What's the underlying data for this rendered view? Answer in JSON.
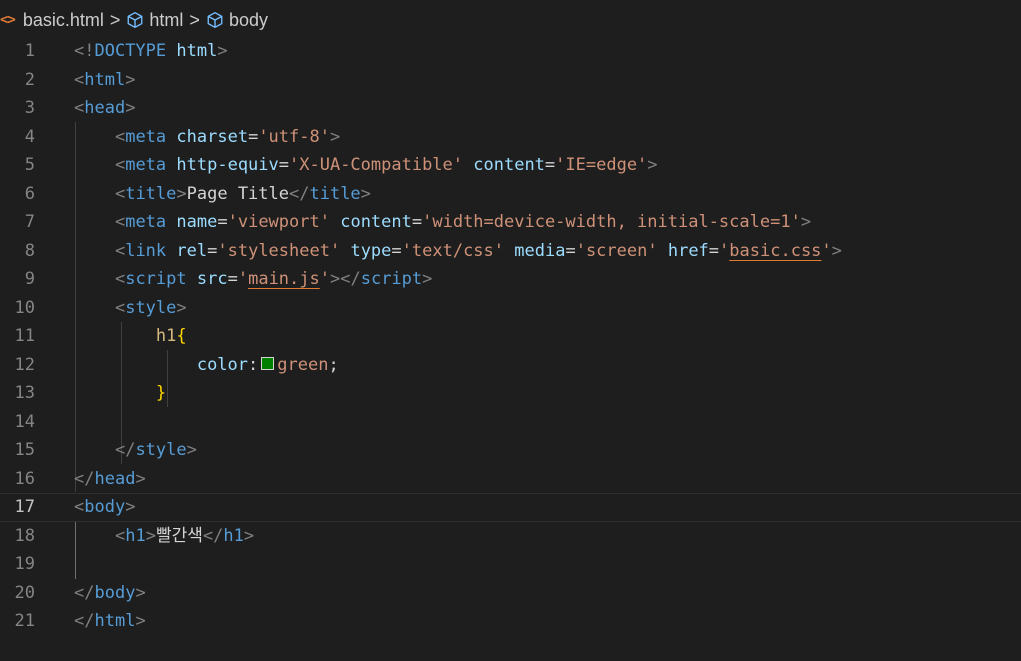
{
  "breadcrumb": {
    "file_icon": "<>",
    "file": "basic.html",
    "items": [
      "html",
      "body"
    ],
    "separator": ">",
    "symbol_icon": "cube-outline-icon"
  },
  "editor": {
    "current_line": 17,
    "color_swatch": "#008000",
    "lines": [
      {
        "n": "1",
        "t": [
          [
            "p",
            "<!"
          ],
          [
            "k",
            "DOCTYPE"
          ],
          [
            "x",
            " "
          ],
          [
            "a",
            "html"
          ],
          [
            "p",
            ">"
          ]
        ]
      },
      {
        "n": "2",
        "t": [
          [
            "p",
            "<"
          ],
          [
            "k",
            "html"
          ],
          [
            "p",
            ">"
          ]
        ]
      },
      {
        "n": "3",
        "t": [
          [
            "p",
            "<"
          ],
          [
            "k",
            "head"
          ],
          [
            "p",
            ">"
          ]
        ]
      },
      {
        "n": "4",
        "t": [
          [
            "x",
            "    "
          ],
          [
            "p",
            "<"
          ],
          [
            "k",
            "meta"
          ],
          [
            "x",
            " "
          ],
          [
            "a",
            "charset"
          ],
          [
            "x",
            "="
          ],
          [
            "s",
            "'utf-8'"
          ],
          [
            "p",
            ">"
          ]
        ]
      },
      {
        "n": "5",
        "t": [
          [
            "x",
            "    "
          ],
          [
            "p",
            "<"
          ],
          [
            "k",
            "meta"
          ],
          [
            "x",
            " "
          ],
          [
            "a",
            "http-equiv"
          ],
          [
            "x",
            "="
          ],
          [
            "s",
            "'X-UA-Compatible'"
          ],
          [
            "x",
            " "
          ],
          [
            "a",
            "content"
          ],
          [
            "x",
            "="
          ],
          [
            "s",
            "'IE=edge'"
          ],
          [
            "p",
            ">"
          ]
        ]
      },
      {
        "n": "6",
        "t": [
          [
            "x",
            "    "
          ],
          [
            "p",
            "<"
          ],
          [
            "k",
            "title"
          ],
          [
            "p",
            ">"
          ],
          [
            "x",
            "Page Title"
          ],
          [
            "p",
            "</"
          ],
          [
            "k",
            "title"
          ],
          [
            "p",
            ">"
          ]
        ]
      },
      {
        "n": "7",
        "t": [
          [
            "x",
            "    "
          ],
          [
            "p",
            "<"
          ],
          [
            "k",
            "meta"
          ],
          [
            "x",
            " "
          ],
          [
            "a",
            "name"
          ],
          [
            "x",
            "="
          ],
          [
            "s",
            "'viewport'"
          ],
          [
            "x",
            " "
          ],
          [
            "a",
            "content"
          ],
          [
            "x",
            "="
          ],
          [
            "s",
            "'width=device-width, initial-scale=1'"
          ],
          [
            "p",
            ">"
          ]
        ]
      },
      {
        "n": "8",
        "t": [
          [
            "x",
            "    "
          ],
          [
            "p",
            "<"
          ],
          [
            "k",
            "link"
          ],
          [
            "x",
            " "
          ],
          [
            "a",
            "rel"
          ],
          [
            "x",
            "="
          ],
          [
            "s",
            "'stylesheet'"
          ],
          [
            "x",
            " "
          ],
          [
            "a",
            "type"
          ],
          [
            "x",
            "="
          ],
          [
            "s",
            "'text/css'"
          ],
          [
            "x",
            " "
          ],
          [
            "a",
            "media"
          ],
          [
            "x",
            "="
          ],
          [
            "s",
            "'screen'"
          ],
          [
            "x",
            " "
          ],
          [
            "a",
            "href"
          ],
          [
            "x",
            "="
          ],
          [
            "s",
            "'"
          ],
          [
            "u",
            "basic.css"
          ],
          [
            "s",
            "'"
          ],
          [
            "p",
            ">"
          ]
        ]
      },
      {
        "n": "9",
        "t": [
          [
            "x",
            "    "
          ],
          [
            "p",
            "<"
          ],
          [
            "k",
            "script"
          ],
          [
            "x",
            " "
          ],
          [
            "a",
            "src"
          ],
          [
            "x",
            "="
          ],
          [
            "s",
            "'"
          ],
          [
            "u",
            "main.js"
          ],
          [
            "s",
            "'"
          ],
          [
            "p",
            "></"
          ],
          [
            "k",
            "script"
          ],
          [
            "p",
            ">"
          ]
        ]
      },
      {
        "n": "10",
        "t": [
          [
            "x",
            "    "
          ],
          [
            "p",
            "<"
          ],
          [
            "k",
            "style"
          ],
          [
            "p",
            ">"
          ]
        ]
      },
      {
        "n": "11",
        "t": [
          [
            "x",
            "        "
          ],
          [
            "sel",
            "h1"
          ],
          [
            "b",
            "{"
          ]
        ]
      },
      {
        "n": "12",
        "t": [
          [
            "x",
            "            "
          ],
          [
            "pr",
            "color"
          ],
          [
            "x",
            ":"
          ],
          [
            "sw",
            ""
          ],
          [
            "s",
            "green"
          ],
          [
            "x",
            ";"
          ]
        ]
      },
      {
        "n": "13",
        "t": [
          [
            "x",
            "        "
          ],
          [
            "b",
            "}"
          ]
        ]
      },
      {
        "n": "14",
        "t": []
      },
      {
        "n": "15",
        "t": [
          [
            "x",
            "    "
          ],
          [
            "p",
            "</"
          ],
          [
            "k",
            "style"
          ],
          [
            "p",
            ">"
          ]
        ]
      },
      {
        "n": "16",
        "t": [
          [
            "p",
            "</"
          ],
          [
            "k",
            "head"
          ],
          [
            "p",
            ">"
          ]
        ]
      },
      {
        "n": "17",
        "t": [
          [
            "p",
            "<"
          ],
          [
            "k",
            "body"
          ],
          [
            "p",
            ">"
          ]
        ]
      },
      {
        "n": "18",
        "t": [
          [
            "x",
            "    "
          ],
          [
            "p",
            "<"
          ],
          [
            "k",
            "h1"
          ],
          [
            "p",
            ">"
          ],
          [
            "h",
            "빨간색"
          ],
          [
            "p",
            "</"
          ],
          [
            "k",
            "h1"
          ],
          [
            "p",
            ">"
          ]
        ]
      },
      {
        "n": "19",
        "t": []
      },
      {
        "n": "20",
        "t": [
          [
            "p",
            "</"
          ],
          [
            "k",
            "body"
          ],
          [
            "p",
            ">"
          ]
        ]
      },
      {
        "n": "21",
        "t": [
          [
            "p",
            "</"
          ],
          [
            "k",
            "html"
          ],
          [
            "p",
            ">"
          ]
        ]
      }
    ]
  }
}
